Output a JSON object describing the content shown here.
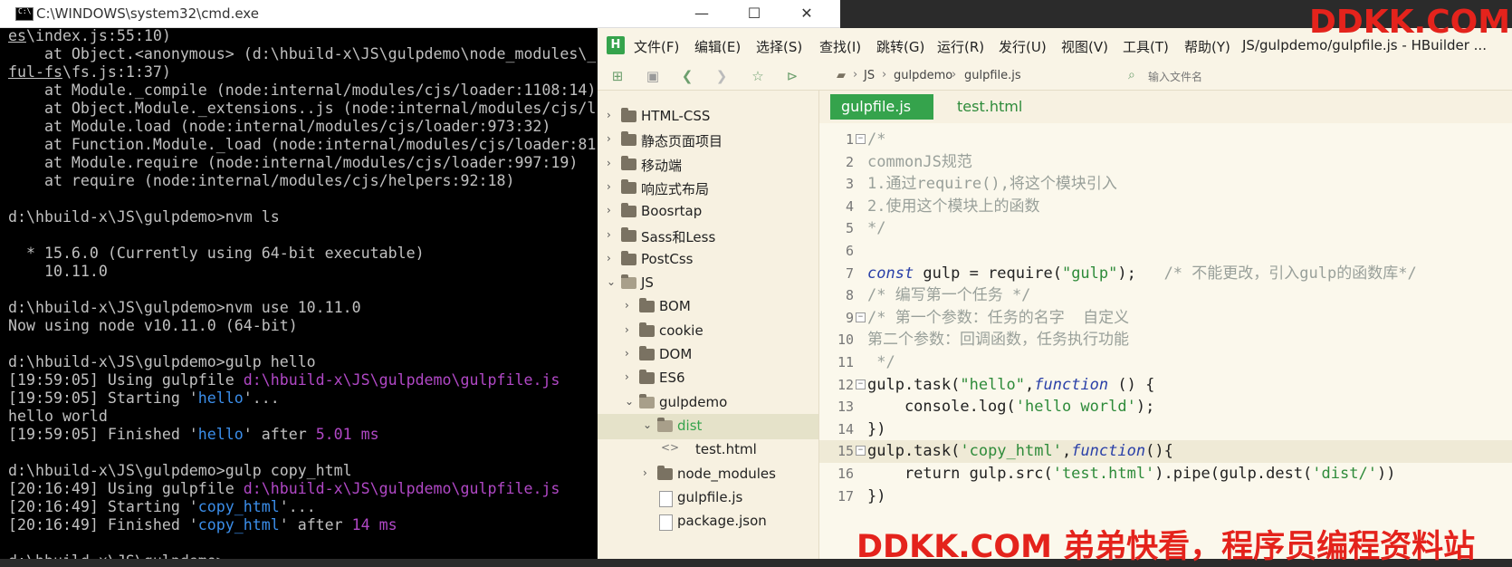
{
  "cmd": {
    "title": "C:\\WINDOWS\\system32\\cmd.exe",
    "min": "—",
    "max": "☐",
    "close": "✕",
    "lines": [
      [
        {
          "t": "es",
          "c": "ul"
        },
        {
          "t": "\\index.js:55:10)"
        }
      ],
      [
        {
          "t": "    at Object.<anonymous> (d:\\hbuild-x\\JS\\gulpdemo\\node_modules\\_"
        }
      ],
      [
        {
          "t": "ful-fs",
          "c": "ul"
        },
        {
          "t": "\\fs.js:1:37)"
        }
      ],
      [
        {
          "t": "    at Module._compile (node:internal/modules/cjs/loader:1108:14)"
        }
      ],
      [
        {
          "t": "    at Object.Module._extensions..js (node:internal/modules/cjs/l"
        }
      ],
      [
        {
          "t": "    at Module.load (node:internal/modules/cjs/loader:973:32)"
        }
      ],
      [
        {
          "t": "    at Function.Module._load (node:internal/modules/cjs/loader:81"
        }
      ],
      [
        {
          "t": "    at Module.require (node:internal/modules/cjs/loader:997:19)"
        }
      ],
      [
        {
          "t": "    at require (node:internal/modules/cjs/helpers:92:18)"
        }
      ],
      [
        {
          "t": ""
        }
      ],
      [
        {
          "t": "d:\\hbuild-x\\JS\\gulpdemo>nvm ls"
        }
      ],
      [
        {
          "t": ""
        }
      ],
      [
        {
          "t": "  * 15.6.0 (Currently using 64-bit executable)"
        }
      ],
      [
        {
          "t": "    10.11.0"
        }
      ],
      [
        {
          "t": ""
        }
      ],
      [
        {
          "t": "d:\\hbuild-x\\JS\\gulpdemo>nvm use 10.11.0"
        }
      ],
      [
        {
          "t": "Now using node v10.11.0 (64-bit)"
        }
      ],
      [
        {
          "t": ""
        }
      ],
      [
        {
          "t": "d:\\hbuild-x\\JS\\gulpdemo>gulp hello"
        }
      ],
      [
        {
          "t": "[19:59:05] Using gulpfile "
        },
        {
          "t": "d:\\hbuild-x\\JS\\gulpdemo\\gulpfile.js",
          "c": "c-mag"
        }
      ],
      [
        {
          "t": "[19:59:05] Starting '"
        },
        {
          "t": "hello",
          "c": "c-blue"
        },
        {
          "t": "'..."
        }
      ],
      [
        {
          "t": "hello world"
        }
      ],
      [
        {
          "t": "[19:59:05] Finished '"
        },
        {
          "t": "hello",
          "c": "c-blue"
        },
        {
          "t": "' after "
        },
        {
          "t": "5.01 ms",
          "c": "c-mag"
        }
      ],
      [
        {
          "t": ""
        }
      ],
      [
        {
          "t": "d:\\hbuild-x\\JS\\gulpdemo>gulp copy_html"
        }
      ],
      [
        {
          "t": "[20:16:49] Using gulpfile "
        },
        {
          "t": "d:\\hbuild-x\\JS\\gulpdemo\\gulpfile.js",
          "c": "c-mag"
        }
      ],
      [
        {
          "t": "[20:16:49] Starting '"
        },
        {
          "t": "copy_html",
          "c": "c-blue"
        },
        {
          "t": "'..."
        }
      ],
      [
        {
          "t": "[20:16:49] Finished '"
        },
        {
          "t": "copy_html",
          "c": "c-blue"
        },
        {
          "t": "' after "
        },
        {
          "t": "14 ms",
          "c": "c-mag"
        }
      ],
      [
        {
          "t": ""
        }
      ],
      [
        {
          "t": "d:\\hbuild-x\\JS\\gulpdemo>"
        }
      ]
    ]
  },
  "hbuilder": {
    "logo": "H",
    "menu": [
      "文件(F)",
      "编辑(E)",
      "选择(S)",
      "查找(I)",
      "跳转(G)",
      "运行(R)",
      "发行(U)",
      "视图(V)",
      "工具(T)",
      "帮助(Y)"
    ],
    "window_title": "JS/gulpdemo/gulpfile.js - HBuilder ...",
    "breadcrumb": [
      "JS",
      "gulpdemo",
      "gulpfile.js"
    ],
    "file_search_placeholder": "输入文件名",
    "tree": [
      {
        "label": "HTML-CSS",
        "depth": 0,
        "open": false,
        "kind": "folder"
      },
      {
        "label": "静态页面项目",
        "depth": 0,
        "open": false,
        "kind": "folder"
      },
      {
        "label": "移动端",
        "depth": 0,
        "open": false,
        "kind": "folder"
      },
      {
        "label": "响应式布局",
        "depth": 0,
        "open": false,
        "kind": "folder"
      },
      {
        "label": "Boosrtap",
        "depth": 0,
        "open": false,
        "kind": "folder"
      },
      {
        "label": "Sass和Less",
        "depth": 0,
        "open": false,
        "kind": "folder"
      },
      {
        "label": "PostCss",
        "depth": 0,
        "open": false,
        "kind": "folder"
      },
      {
        "label": "JS",
        "depth": 0,
        "open": true,
        "kind": "folder"
      },
      {
        "label": "BOM",
        "depth": 1,
        "open": false,
        "kind": "folder"
      },
      {
        "label": "cookie",
        "depth": 1,
        "open": false,
        "kind": "folder"
      },
      {
        "label": "DOM",
        "depth": 1,
        "open": false,
        "kind": "folder"
      },
      {
        "label": "ES6",
        "depth": 1,
        "open": false,
        "kind": "folder"
      },
      {
        "label": "gulpdemo",
        "depth": 1,
        "open": true,
        "kind": "folder"
      },
      {
        "label": "dist",
        "depth": 2,
        "open": true,
        "kind": "folder",
        "selected": true
      },
      {
        "label": "test.html",
        "depth": 3,
        "kind": "html"
      },
      {
        "label": "node_modules",
        "depth": 2,
        "open": false,
        "kind": "folder"
      },
      {
        "label": "gulpfile.js",
        "depth": 2,
        "kind": "file"
      },
      {
        "label": "package.json",
        "depth": 2,
        "kind": "file"
      }
    ],
    "tabs": [
      {
        "label": "gulpfile.js",
        "active": true
      },
      {
        "label": "test.html",
        "active": false
      }
    ],
    "code": [
      {
        "n": "1",
        "fold": "⊟",
        "tokens": [
          {
            "t": "/*",
            "c": "k-cmt"
          }
        ]
      },
      {
        "n": "2",
        "tokens": [
          {
            "t": "commonJS规范",
            "c": "k-cmt"
          }
        ]
      },
      {
        "n": "3",
        "tokens": [
          {
            "t": "1.通过require(),将这个模块引入",
            "c": "k-cmt"
          }
        ]
      },
      {
        "n": "4",
        "tokens": [
          {
            "t": "2.使用这个模块上的函数",
            "c": "k-cmt"
          }
        ]
      },
      {
        "n": "5",
        "tokens": [
          {
            "t": "*/",
            "c": "k-cmt"
          }
        ]
      },
      {
        "n": "6",
        "tokens": []
      },
      {
        "n": "7",
        "tokens": [
          {
            "t": "const",
            "c": "k-kw"
          },
          {
            "t": " gulp = require(",
            "c": "k-def"
          },
          {
            "t": "\"gulp\"",
            "c": "k-str"
          },
          {
            "t": ");   ",
            "c": "k-def"
          },
          {
            "t": "/* 不能更改，引入gulp的函数库*/",
            "c": "k-cmt"
          }
        ]
      },
      {
        "n": "8",
        "tokens": [
          {
            "t": "/* 编写第一个任务 */",
            "c": "k-cmt"
          }
        ]
      },
      {
        "n": "9",
        "fold": "⊟",
        "tokens": [
          {
            "t": "/* 第一个参数：任务的名字  自定义",
            "c": "k-cmt"
          }
        ]
      },
      {
        "n": "10",
        "tokens": [
          {
            "t": "第二个参数：回调函数，任务执行功能",
            "c": "k-cmt"
          }
        ]
      },
      {
        "n": "11",
        "tokens": [
          {
            "t": " */",
            "c": "k-cmt"
          }
        ]
      },
      {
        "n": "12",
        "fold": "⊟",
        "tokens": [
          {
            "t": "gulp.task(",
            "c": "k-def"
          },
          {
            "t": "\"hello\"",
            "c": "k-str"
          },
          {
            "t": ",",
            "c": "k-def"
          },
          {
            "t": "function",
            "c": "k-kw"
          },
          {
            "t": " () {",
            "c": "k-def"
          }
        ]
      },
      {
        "n": "13",
        "tokens": [
          {
            "t": "    console.log(",
            "c": "k-def"
          },
          {
            "t": "'hello world'",
            "c": "k-str"
          },
          {
            "t": ");",
            "c": "k-def"
          }
        ]
      },
      {
        "n": "14",
        "tokens": [
          {
            "t": "})",
            "c": "k-def"
          }
        ]
      },
      {
        "n": "15",
        "fold": "⊟",
        "hl": true,
        "tokens": [
          {
            "t": "gulp.task(",
            "c": "k-def"
          },
          {
            "t": "'copy_html'",
            "c": "k-str"
          },
          {
            "t": ",",
            "c": "k-def"
          },
          {
            "t": "function",
            "c": "k-kw"
          },
          {
            "t": "(){",
            "c": "k-def"
          }
        ]
      },
      {
        "n": "16",
        "tokens": [
          {
            "t": "    return gulp.src(",
            "c": "k-def"
          },
          {
            "t": "'test.html'",
            "c": "k-str"
          },
          {
            "t": ").pipe(gulp.dest(",
            "c": "k-def"
          },
          {
            "t": "'dist/'",
            "c": "k-str"
          },
          {
            "t": "))",
            "c": "k-def"
          }
        ]
      },
      {
        "n": "17",
        "tokens": [
          {
            "t": "})",
            "c": "k-def"
          }
        ]
      }
    ]
  },
  "watermark": {
    "top": "DDKK.COM",
    "bottom": "DDKK.COM 弟弟快看，程序员编程资料站",
    "color": "#e4231c"
  }
}
